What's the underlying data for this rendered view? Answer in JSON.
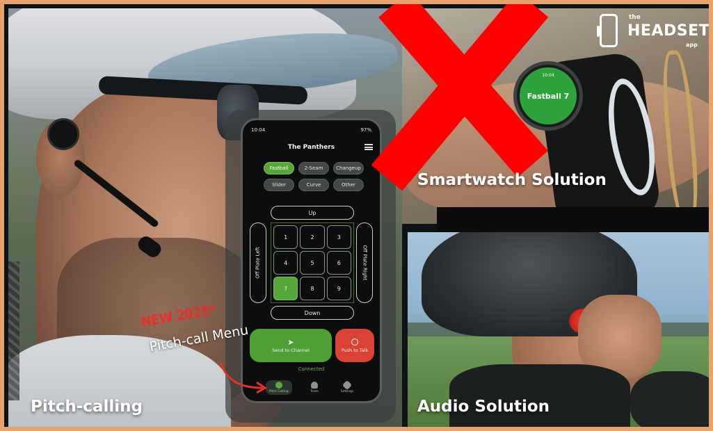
{
  "colors": {
    "frame": "#e6a36e",
    "accent_green": "#56a63a",
    "talk_red": "#d94234",
    "connected_green": "#63b848",
    "new_red": "#e3322b",
    "cross_red": "#ff0000"
  },
  "captions": {
    "pitch_calling": "Pitch-calling",
    "smartwatch": "Smartwatch Solution",
    "audio": "Audio Solution"
  },
  "promo": {
    "new": "NEW 2025*",
    "menu": "Pitch-call Menu"
  },
  "logo": {
    "the": "the",
    "main": "HEADSET",
    "app": "app"
  },
  "phone": {
    "status_time": "10:04",
    "status_right": "97%",
    "team": "The Panthers",
    "pitches": [
      {
        "label": "Fastball",
        "active": true
      },
      {
        "label": "2-Seam",
        "active": false
      },
      {
        "label": "Changeup",
        "active": false
      },
      {
        "label": "Slider",
        "active": false
      },
      {
        "label": "Curve",
        "active": false
      },
      {
        "label": "Other",
        "active": false
      }
    ],
    "zone_up": "Up",
    "zone_down": "Down",
    "zone_left": "Off Plate Left",
    "zone_right": "Off Plate Right",
    "cells": [
      "1",
      "2",
      "3",
      "4",
      "5",
      "6",
      "7",
      "8",
      "9"
    ],
    "active_cell": "7",
    "send_label": "Send to Channel",
    "talk_label": "Push to Talk",
    "connected": "Connected",
    "nav": [
      {
        "label": "Pitch Calling",
        "icon": "baseball-icon",
        "active": true
      },
      {
        "label": "Team",
        "icon": "people-icon",
        "active": false
      },
      {
        "label": "Settings",
        "icon": "gear-icon",
        "active": false
      }
    ]
  },
  "watch": {
    "time": "10:04",
    "text": "Fastball 7"
  }
}
